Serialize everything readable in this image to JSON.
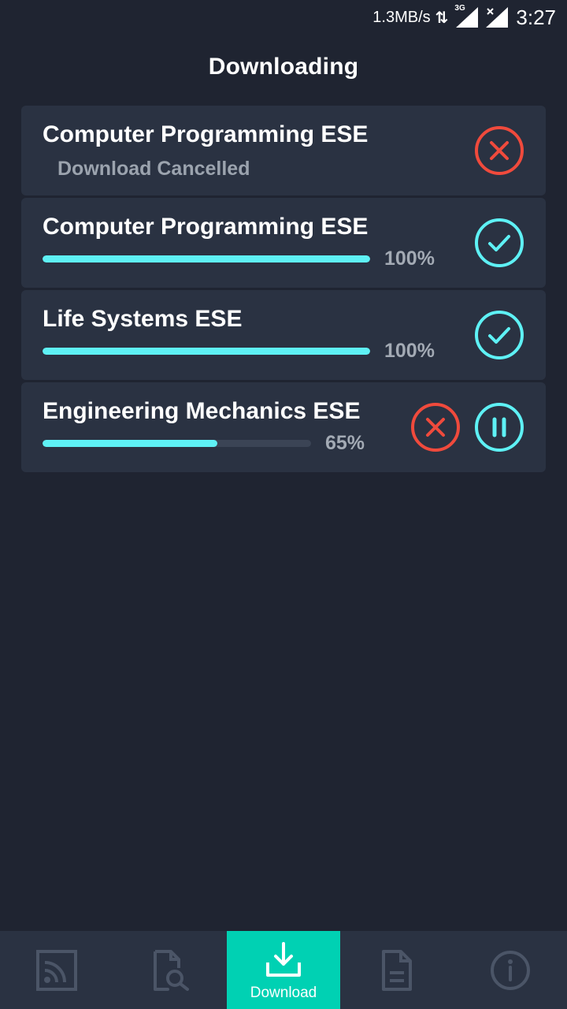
{
  "status_bar": {
    "net_speed": "1.3MB/s",
    "data_arrows": "⇅",
    "network_label": "3G",
    "clock": "3:27"
  },
  "header": {
    "title": "Downloading"
  },
  "colors": {
    "background": "#1f2431",
    "card": "#2a3242",
    "accent_cyan": "#5ef1f5",
    "cancel_red": "#f04a3c",
    "active_tab": "#00d1b3"
  },
  "downloads": [
    {
      "title": "Computer Programming ESE",
      "status": "Download Cancelled",
      "actions": [
        "cancelled-icon"
      ]
    },
    {
      "title": "Computer Programming ESE",
      "progress": 1.0,
      "progress_label": "100%",
      "actions": [
        "completed-check-icon"
      ]
    },
    {
      "title": "Life Systems ESE",
      "progress": 1.0,
      "progress_label": "100%",
      "actions": [
        "completed-check-icon"
      ]
    },
    {
      "title": "Engineering Mechanics ESE",
      "progress": 0.65,
      "progress_label": "65%",
      "actions": [
        "cancel-icon",
        "pause-icon"
      ]
    }
  ],
  "bottom_nav": {
    "items": [
      {
        "icon": "feed-icon",
        "label": ""
      },
      {
        "icon": "document-search-icon",
        "label": ""
      },
      {
        "icon": "download-icon",
        "label": "Download",
        "active": true
      },
      {
        "icon": "document-icon",
        "label": ""
      },
      {
        "icon": "info-icon",
        "label": ""
      }
    ]
  }
}
